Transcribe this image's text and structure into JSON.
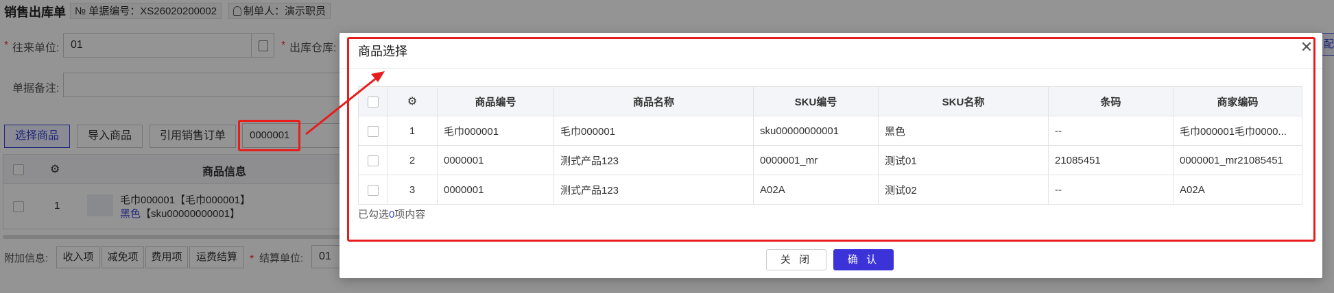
{
  "page": {
    "title": "销售出库单",
    "doc_no_label": "№ 单据编号：",
    "doc_no": "XS26020200002",
    "maker_label": "制单人：",
    "maker": "演示职员",
    "partner_label": "往来单位:",
    "partner_value": "01",
    "warehouse_label": "出库仓库:",
    "remark_label": "单据备注:",
    "right_edge_text": "配",
    "toolbar": {
      "select_goods": "选择商品",
      "import_goods": "导入商品",
      "ref_order": "引用销售订单",
      "search_value": "0000001"
    },
    "grid": {
      "header_info": "商品信息",
      "row_index": "1",
      "row_name": "毛巾000001【毛巾000001】",
      "row_sku_color": "黑色",
      "row_sku": "【sku00000000001】"
    },
    "extra_label": "附加信息:",
    "extra_buttons": [
      "收入项",
      "减免项",
      "费用项",
      "运费结算"
    ],
    "settle_label": "结算单位:",
    "settle_value": "01"
  },
  "modal": {
    "title": "商品选择",
    "close_glyph": "✕",
    "columns": [
      "商品编号",
      "商品名称",
      "SKU编号",
      "SKU名称",
      "条码",
      "商家编码"
    ],
    "rows": [
      {
        "idx": "1",
        "code": "毛巾000001",
        "name": "毛巾000001",
        "sku_code": "sku00000000001",
        "sku_name": "黑色",
        "barcode": "--",
        "merchant_code": "毛巾000001毛巾0000..."
      },
      {
        "idx": "2",
        "code": "0000001",
        "name": "测式产品123",
        "sku_code": "0000001_mr",
        "sku_name": "测试01",
        "barcode": "21085451",
        "merchant_code": "0000001_mr21085451"
      },
      {
        "idx": "3",
        "code": "0000001",
        "name": "测式产品123",
        "sku_code": "A02A",
        "sku_name": "测试02",
        "barcode": "--",
        "merchant_code": "A02A"
      }
    ],
    "selected_prefix": "已勾选",
    "selected_count": "0",
    "selected_suffix": "项内容",
    "btn_close": "关 闭",
    "btn_ok": "确 认"
  },
  "colors": {
    "accent": "#3b32d8",
    "highlight": "#e81c1c"
  },
  "icons": {
    "settings": "gear-icon",
    "close": "close-icon",
    "doc": "doc-icon",
    "user": "user-icon"
  }
}
